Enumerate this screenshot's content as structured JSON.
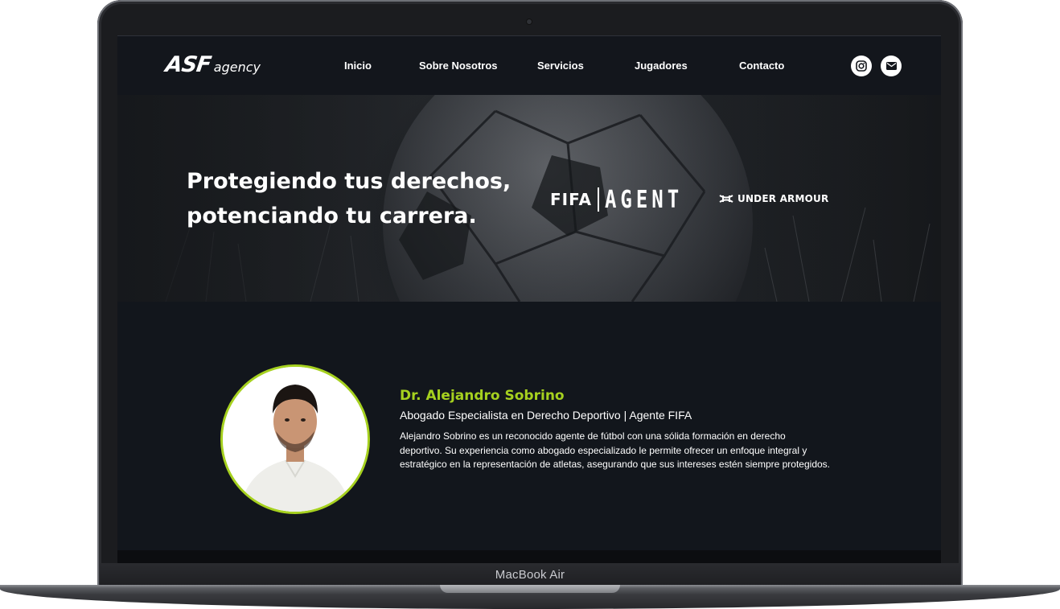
{
  "device": {
    "model_label": "MacBook Air"
  },
  "site": {
    "logo": {
      "mark": "ASF",
      "word": "agency"
    },
    "nav": {
      "links": [
        {
          "label": "Inicio"
        },
        {
          "label": "Sobre Nosotros"
        },
        {
          "label": "Servicios"
        },
        {
          "label": "Jugadores"
        },
        {
          "label": "Contacto"
        }
      ],
      "social": [
        {
          "icon": "instagram-icon"
        },
        {
          "icon": "mail-icon"
        }
      ]
    },
    "hero": {
      "title": "Protegiendo tus derechos, potenciando tu carrera.",
      "partner_fifa_left": "FIFA",
      "partner_fifa_right": "AGENT",
      "partner_ua": "UNDER ARMOUR"
    },
    "profile": {
      "name": "Dr. Alejandro Sobrino",
      "role": "Abogado Especialista en Derecho Deportivo | Agente FIFA",
      "bio": "Alejandro Sobrino es un reconocido agente de fútbol con una sólida formación en derecho deportivo. Su experiencia como abogado especializado le permite ofrecer un enfoque integral y estratégico en la representación de atletas, asegurando que sus intereses estén siempre protegidos."
    },
    "colors": {
      "accent": "#a6d11f",
      "background": "#12161c",
      "text": "#ffffff"
    }
  }
}
